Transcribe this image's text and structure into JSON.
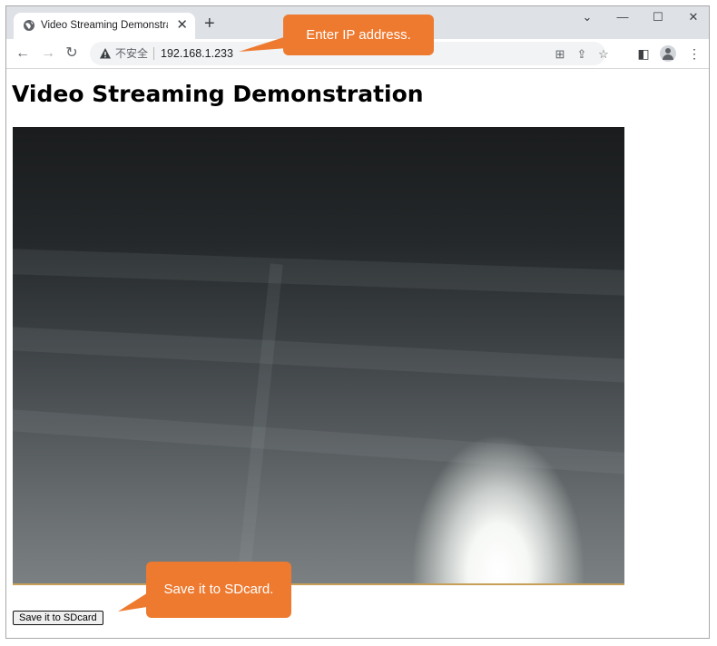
{
  "browser": {
    "tab": {
      "title": "Video Streaming Demonstration",
      "icon": "globe-icon"
    },
    "new_tab_label": "+",
    "window_controls": {
      "dropdown": "⌄",
      "minimize": "—",
      "maximize": "☐",
      "close": "✕"
    },
    "address_bar": {
      "security_label": "不安全",
      "url": "192.168.1.233"
    }
  },
  "page": {
    "title": "Video Streaming Demonstration",
    "save_button_label": "Save it to SDcard"
  },
  "annotations": {
    "ip_callout": "Enter IP address.",
    "sd_callout": "Save it to SDcard.",
    "color": "#ee7a30"
  }
}
